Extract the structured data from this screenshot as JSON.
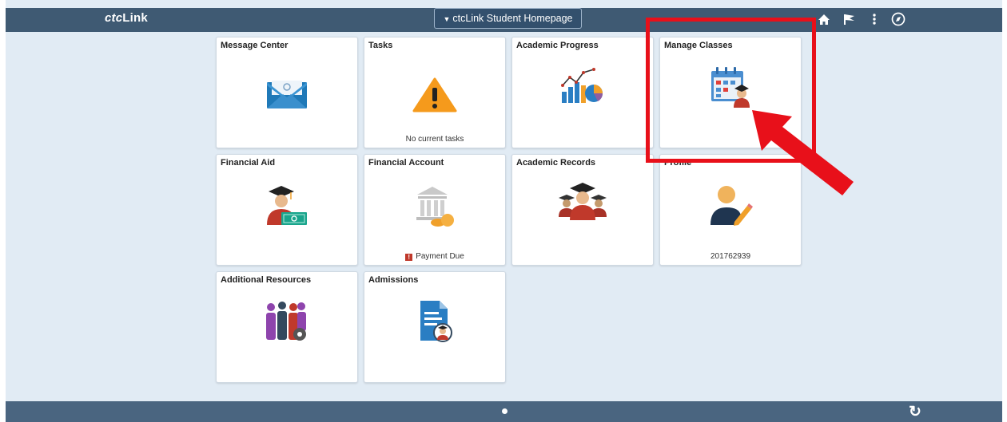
{
  "header": {
    "logo_prefix": "ctc",
    "logo_suffix": "Link",
    "homepage_selector": "ctcLink Student Homepage",
    "icons": [
      "home-icon",
      "flag-icon",
      "more-options-icon",
      "navigator-icon"
    ]
  },
  "tiles": [
    {
      "title": "Message Center",
      "icon": "envelope-icon"
    },
    {
      "title": "Tasks",
      "icon": "warning-icon",
      "footer": "No current tasks"
    },
    {
      "title": "Academic Progress",
      "icon": "charts-icon"
    },
    {
      "title": "Manage Classes",
      "icon": "calendar-student-icon"
    },
    {
      "title": "Financial Aid",
      "icon": "graduate-money-icon"
    },
    {
      "title": "Financial Account",
      "icon": "bank-icon",
      "footer": "Payment Due"
    },
    {
      "title": "Academic Records",
      "icon": "graduates-icon"
    },
    {
      "title": "Profile",
      "icon": "profile-edit-icon",
      "footer": "201762939"
    },
    {
      "title": "Additional Resources",
      "icon": "people-gear-icon"
    },
    {
      "title": "Admissions",
      "icon": "document-student-icon"
    }
  ],
  "footer_bar": {
    "icons": [
      "page-indicator-dot",
      "refresh-icon"
    ]
  },
  "annotation": {
    "highlight_color": "#e8101a"
  },
  "colors": {
    "topbar": "#3f5a73",
    "background": "#e1ebf4",
    "bottombar": "#4a6580"
  }
}
